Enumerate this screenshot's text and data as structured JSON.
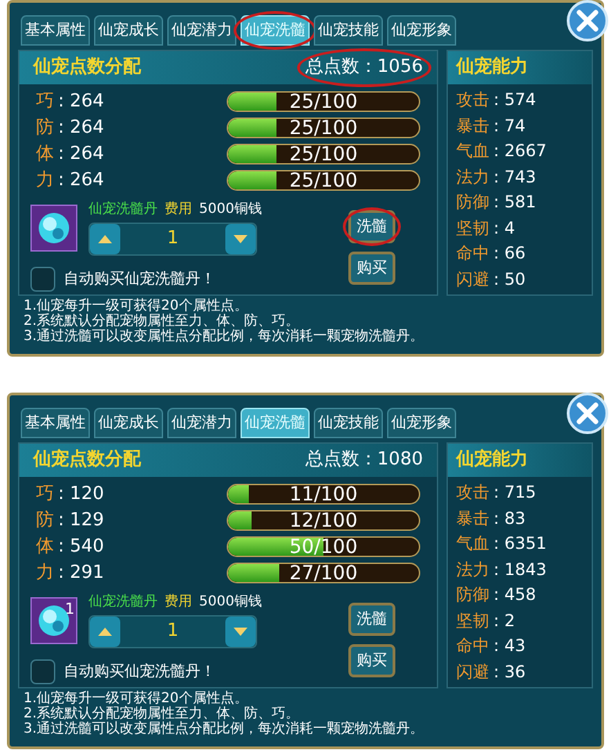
{
  "panels": [
    {
      "tabs": [
        {
          "label": "基本属性",
          "selected": false,
          "circled": false
        },
        {
          "label": "仙宠成长",
          "selected": false,
          "circled": false
        },
        {
          "label": "仙宠潜力",
          "selected": false,
          "circled": false
        },
        {
          "label": "仙宠洗髓",
          "selected": true,
          "circled": true
        },
        {
          "label": "仙宠技能",
          "selected": false,
          "circled": false
        },
        {
          "label": "仙宠形象",
          "selected": false,
          "circled": false
        }
      ],
      "allocation": {
        "title": "仙宠点数分配",
        "total": "总点数：1056",
        "total_circled": true,
        "stats": [
          {
            "label": "巧",
            "value": ": 264",
            "progress": "25/100",
            "level": 0.25
          },
          {
            "label": "防",
            "value": ": 264",
            "progress": "25/100",
            "level": 0.25
          },
          {
            "label": "体",
            "value": ": 264",
            "progress": "25/100",
            "level": 0.25
          },
          {
            "label": "力",
            "value": ": 264",
            "progress": "25/100",
            "level": 0.25
          }
        ],
        "item": {
          "name": "仙宠洗髓丹",
          "cost_label": "费用",
          "cost": "5000铜钱",
          "quantity": "1"
        },
        "auto_buy": {
          "label": "自动购买仙宠洗髓丹！",
          "checked": false
        },
        "buttons": [
          {
            "label": "洗髓",
            "circled": true
          },
          {
            "label": "购买",
            "circled": false
          }
        ]
      },
      "abilities": {
        "title": "仙宠能力",
        "stats": [
          {
            "label": "攻击",
            "value": ": 574"
          },
          {
            "label": "暴击",
            "value": ": 74"
          },
          {
            "label": "气血",
            "value": ": 2667"
          },
          {
            "label": "法力",
            "value": ": 743"
          },
          {
            "label": "防御",
            "value": ": 581"
          },
          {
            "label": "坚韧",
            "value": ": 4"
          },
          {
            "label": "命中",
            "value": ": 66"
          },
          {
            "label": "闪避",
            "value": ": 50"
          }
        ]
      },
      "notes": [
        "1.仙宠每升一级可获得20个属性点。",
        "2.系统默认分配宠物属性至力、体、防、巧。",
        "3.通过洗髓可以改变属性点分配比例，每次消耗一颗宠物洗髓丹。"
      ]
    },
    {
      "tabs": [
        {
          "label": "基本属性",
          "selected": false,
          "circled": false
        },
        {
          "label": "仙宠成长",
          "selected": false,
          "circled": false
        },
        {
          "label": "仙宠潜力",
          "selected": false,
          "circled": false
        },
        {
          "label": "仙宠洗髓",
          "selected": true,
          "circled": false
        },
        {
          "label": "仙宠技能",
          "selected": false,
          "circled": false
        },
        {
          "label": "仙宠形象",
          "selected": false,
          "circled": false
        }
      ],
      "allocation": {
        "title": "仙宠点数分配",
        "total": "总点数：1080",
        "total_circled": false,
        "stats": [
          {
            "label": "巧",
            "value": ": 120",
            "progress": "11/100",
            "level": 0.11
          },
          {
            "label": "防",
            "value": ": 129",
            "progress": "12/100",
            "level": 0.12
          },
          {
            "label": "体",
            "value": ": 540",
            "progress": "50/100",
            "level": 0.5
          },
          {
            "label": "力",
            "value": ": 291",
            "progress": "27/100",
            "level": 0.27
          }
        ],
        "item": {
          "name": "仙宠洗髓丹",
          "cost_label": "费用",
          "cost": "5000铜钱",
          "quantity": "1",
          "count": "1"
        },
        "auto_buy": {
          "label": "自动购买仙宠洗髓丹！",
          "checked": false
        },
        "buttons": [
          {
            "label": "洗髓",
            "circled": false
          },
          {
            "label": "购买",
            "circled": false
          }
        ]
      },
      "abilities": {
        "title": "仙宠能力",
        "stats": [
          {
            "label": "攻击",
            "value": ": 715"
          },
          {
            "label": "暴击",
            "value": ": 83"
          },
          {
            "label": "气血",
            "value": ": 6351"
          },
          {
            "label": "法力",
            "value": ": 1843"
          },
          {
            "label": "防御",
            "value": ": 458"
          },
          {
            "label": "坚韧",
            "value": ": 2"
          },
          {
            "label": "命中",
            "value": ": 43"
          },
          {
            "label": "闪避",
            "value": ": 36"
          }
        ]
      },
      "notes": [
        "1.仙宠每升一级可获得20个属性点。",
        "2.系统默认分配宠物属性至力、体、防、巧。",
        "3.通过洗髓可以改变属性点分配比例，每次消耗一颗宠物洗髓丹。"
      ]
    }
  ]
}
